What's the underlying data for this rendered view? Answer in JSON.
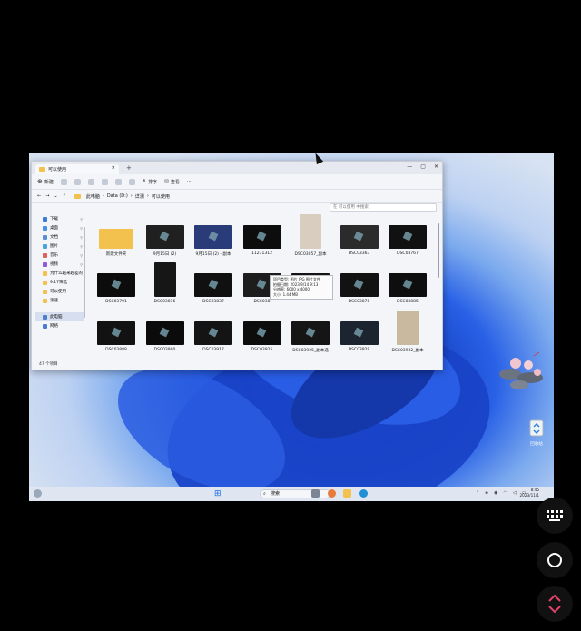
{
  "window": {
    "tab_title": "可以使用",
    "new_tab": "+",
    "controls": {
      "minimize": "—",
      "maximize": "▢",
      "close": "✕"
    },
    "toolbar": {
      "new": "新建",
      "sort": "排序",
      "view": "查看",
      "more": "···"
    },
    "breadcrumbs": [
      "此电脑",
      "Data (D:)",
      "详测",
      "可以使用"
    ],
    "search_placeholder": "在 可以使用 中搜索",
    "status": "47 个项目"
  },
  "sidebar": {
    "items": [
      {
        "label": "下载",
        "color": "#3a7bd5"
      },
      {
        "label": "桌面",
        "color": "#4a90e2"
      },
      {
        "label": "文档",
        "color": "#5a8fd6"
      },
      {
        "label": "图片",
        "color": "#4aa3df"
      },
      {
        "label": "音乐",
        "color": "#e06060"
      },
      {
        "label": "视频",
        "color": "#8e5bd8"
      },
      {
        "label": "为什么越来越差的",
        "color": "#f2c14e"
      },
      {
        "label": "9.17筛选",
        "color": "#f2c14e"
      },
      {
        "label": "可以使用",
        "color": "#f2c14e"
      },
      {
        "label": "测速",
        "color": "#f2c14e"
      }
    ],
    "bottom": [
      "此电脑",
      "网络"
    ]
  },
  "files": [
    {
      "name": "新建文件夹",
      "thumb": "#f2c14e"
    },
    {
      "name": "9月15日 (2)",
      "thumb": "#202020"
    },
    {
      "name": "9月15日 (2) - 副本",
      "thumb": "#2a3b7a"
    },
    {
      "name": "11231312",
      "thumb": "#0d0d0d"
    },
    {
      "name": "DSC03057_副本",
      "thumb": "#d9cdbf"
    },
    {
      "name": "DSC03363",
      "thumb": "#2b2b2b"
    },
    {
      "name": "DSC03767",
      "thumb": "#111111"
    },
    {
      "name": "DSC03791",
      "thumb": "#0c0c0c"
    },
    {
      "name": "DSC03816",
      "thumb": "#161616"
    },
    {
      "name": "DSC03837",
      "thumb": "#101010"
    },
    {
      "name": "DSC038",
      "thumb": "#1d1d1d"
    },
    {
      "name": "",
      "thumb": "#141414"
    },
    {
      "name": "DSC03878",
      "thumb": "#121212"
    },
    {
      "name": "DSC03885",
      "thumb": "#0e0e0e"
    },
    {
      "name": "DSC03888",
      "thumb": "#121212"
    },
    {
      "name": "DSC03900",
      "thumb": "#0b0b0b"
    },
    {
      "name": "DSC03917",
      "thumb": "#141414"
    },
    {
      "name": "DSC03925",
      "thumb": "#0d0d0d"
    },
    {
      "name": "DSC03925_副本选",
      "thumb": "#151515"
    },
    {
      "name": "DSC03929",
      "thumb": "#1c2430"
    },
    {
      "name": "DSC03932_副本",
      "thumb": "#c9b99f"
    }
  ],
  "tooltip": {
    "type": "项目类型: 图片 JPG 图片文件",
    "date": "拍摄日期: 2023/9/14 9:13",
    "dims": "分辨率: 6000 x 4000",
    "size": "大小: 1.44 MB"
  },
  "taskbar": {
    "search": "搜索",
    "time": "8:45",
    "date": "2023/11/1"
  },
  "desktop": {
    "recycle_label": "回收站"
  }
}
